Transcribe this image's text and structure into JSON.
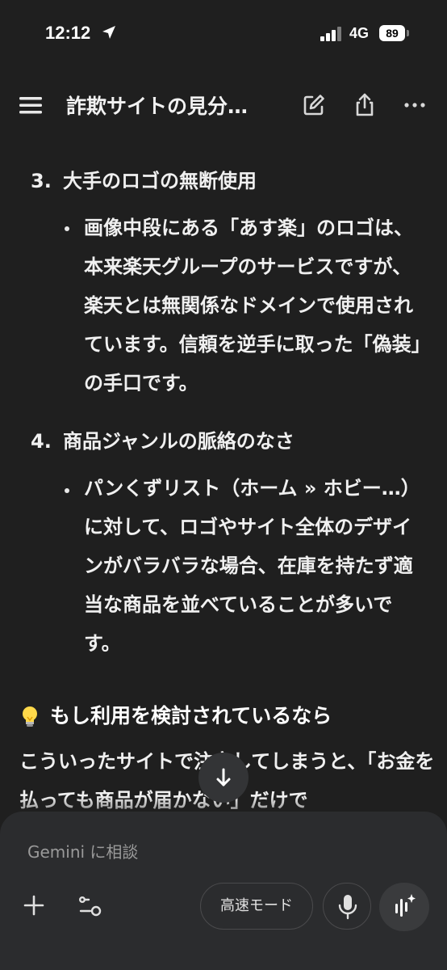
{
  "status_bar": {
    "time": "12:12",
    "network": "4G",
    "battery": "89"
  },
  "header": {
    "title": "詐欺サイトの見分…"
  },
  "content": {
    "list": [
      {
        "number": "3.",
        "heading": "大手のロゴの無断使用",
        "bullet": "画像中段にある「あす楽」のロゴは、本来楽天グループのサービスですが、楽天とは無関係なドメインで使用されています。信頼を逆手に取った「偽装」の手口です。"
      },
      {
        "number": "4.",
        "heading": "商品ジャンルの脈絡のなさ",
        "bullet": "パンくずリスト（ホーム » ホビー…）に対して、ロゴやサイト全体のデザインがバラバラな場合、在庫を持たず適当な商品を並べていることが多いです。"
      }
    ],
    "tip_heading": "もし利用を検討されているなら",
    "paragraph": "こういったサイトで注文してしまうと、「お金を払っても商品が届かない」だけで"
  },
  "composer": {
    "placeholder": "Gemini に相談",
    "mode_label": "高速モード"
  }
}
